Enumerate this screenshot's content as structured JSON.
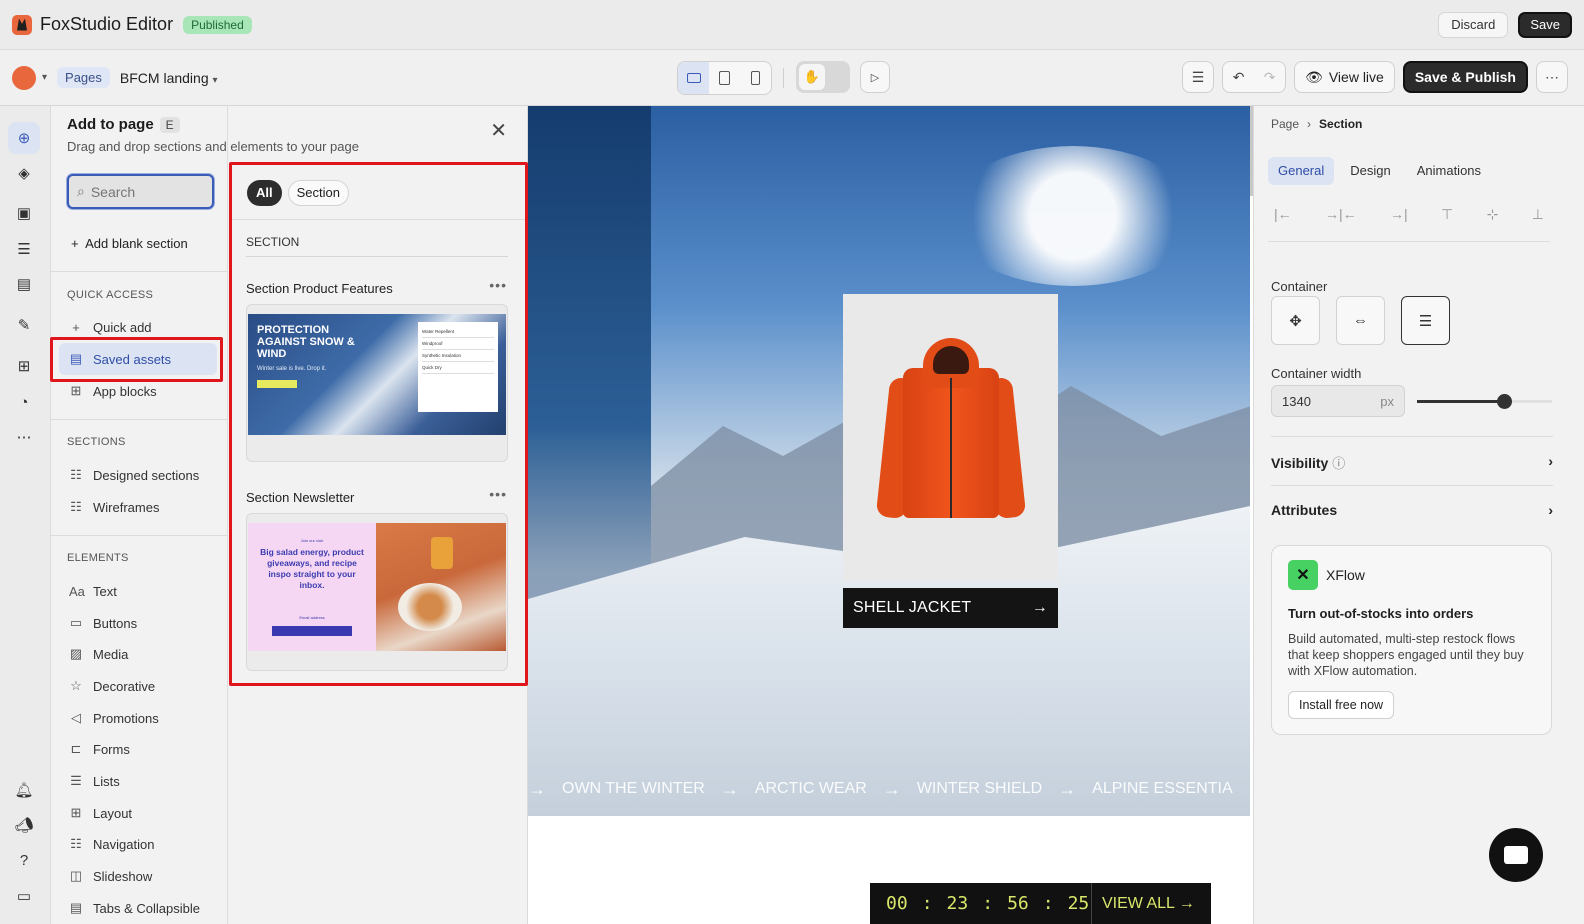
{
  "topbar": {
    "app_title": "FoxStudio Editor",
    "status_badge": "Published",
    "discard_label": "Discard",
    "save_label": "Save"
  },
  "toolbar": {
    "pages_label": "Pages",
    "page_name": "BFCM landing",
    "view_live_label": "View live",
    "save_publish_label": "Save & Publish"
  },
  "rail": {
    "icons": [
      "add-icon",
      "layers-icon",
      "theme-icon",
      "sections-icon",
      "pages-icon",
      "brush-icon",
      "apps-icon",
      "speed-icon",
      "more-icon",
      "bell-icon",
      "megaphone-icon",
      "help-icon",
      "chat-icon"
    ]
  },
  "add_panel": {
    "title": "Add to page",
    "shortcut": "E",
    "subtitle": "Drag and drop sections and elements to your page",
    "search_placeholder": "Search",
    "add_blank_label": "Add blank section",
    "quick_access_label": "QUICK ACCESS",
    "quick_access": [
      "Quick add",
      "Saved assets",
      "App blocks"
    ],
    "sections_label": "SECTIONS",
    "sections": [
      "Designed sections",
      "Wireframes"
    ],
    "elements_label": "ELEMENTS",
    "elements": [
      "Text",
      "Buttons",
      "Media",
      "Decorative",
      "Promotions",
      "Forms",
      "Lists",
      "Layout",
      "Navigation",
      "Slideshow",
      "Tabs & Collapsible"
    ]
  },
  "assets": {
    "filters": [
      "All",
      "Section"
    ],
    "active_filter": "All",
    "group_label": "SECTION",
    "cards": [
      {
        "title": "Section Product Features",
        "thumb_heading": "PROTECTION AGAINST SNOW & WIND",
        "thumb_sub": "Winter sale is live. Drop it.",
        "thumb_list": [
          "Water Repellent",
          "Windproof",
          "Synthetic Insulation",
          "Quick Dry"
        ]
      },
      {
        "title": "Section Newsletter",
        "thumb_kicker": "Join our club",
        "thumb_heading": "Big salad energy, product giveaways, and recipe inspo straight to your inbox.",
        "thumb_email": "Email address"
      }
    ]
  },
  "canvas": {
    "product_cta": "SHELL JACKET",
    "marquee": [
      "OWN THE WINTER",
      "ARCTIC WEAR",
      "WINTER SHIELD",
      "ALPINE ESSENTIA"
    ],
    "countdown": [
      "00",
      "23",
      "56",
      "25"
    ],
    "view_all": "VIEW ALL"
  },
  "right_panel": {
    "breadcrumb": [
      "Page",
      "Section"
    ],
    "tabs": [
      "General",
      "Design",
      "Animations"
    ],
    "active_tab": "General",
    "container_label": "Container",
    "container_width_label": "Container width",
    "container_width_value": "1340",
    "container_width_unit": "px",
    "visibility_label": "Visibility",
    "attributes_label": "Attributes",
    "xflow": {
      "name": "XFlow",
      "title": "Turn out-of-stocks into orders",
      "desc": "Build automated, multi-step restock flows that keep shoppers engaged until they buy with XFlow automation.",
      "button": "Install free now"
    }
  },
  "colors": {
    "accent": "#3b5bb8",
    "highlight_red": "#e0161d",
    "badge_green": "#a8e6b8",
    "countdown_yellow": "#d9e66a"
  }
}
